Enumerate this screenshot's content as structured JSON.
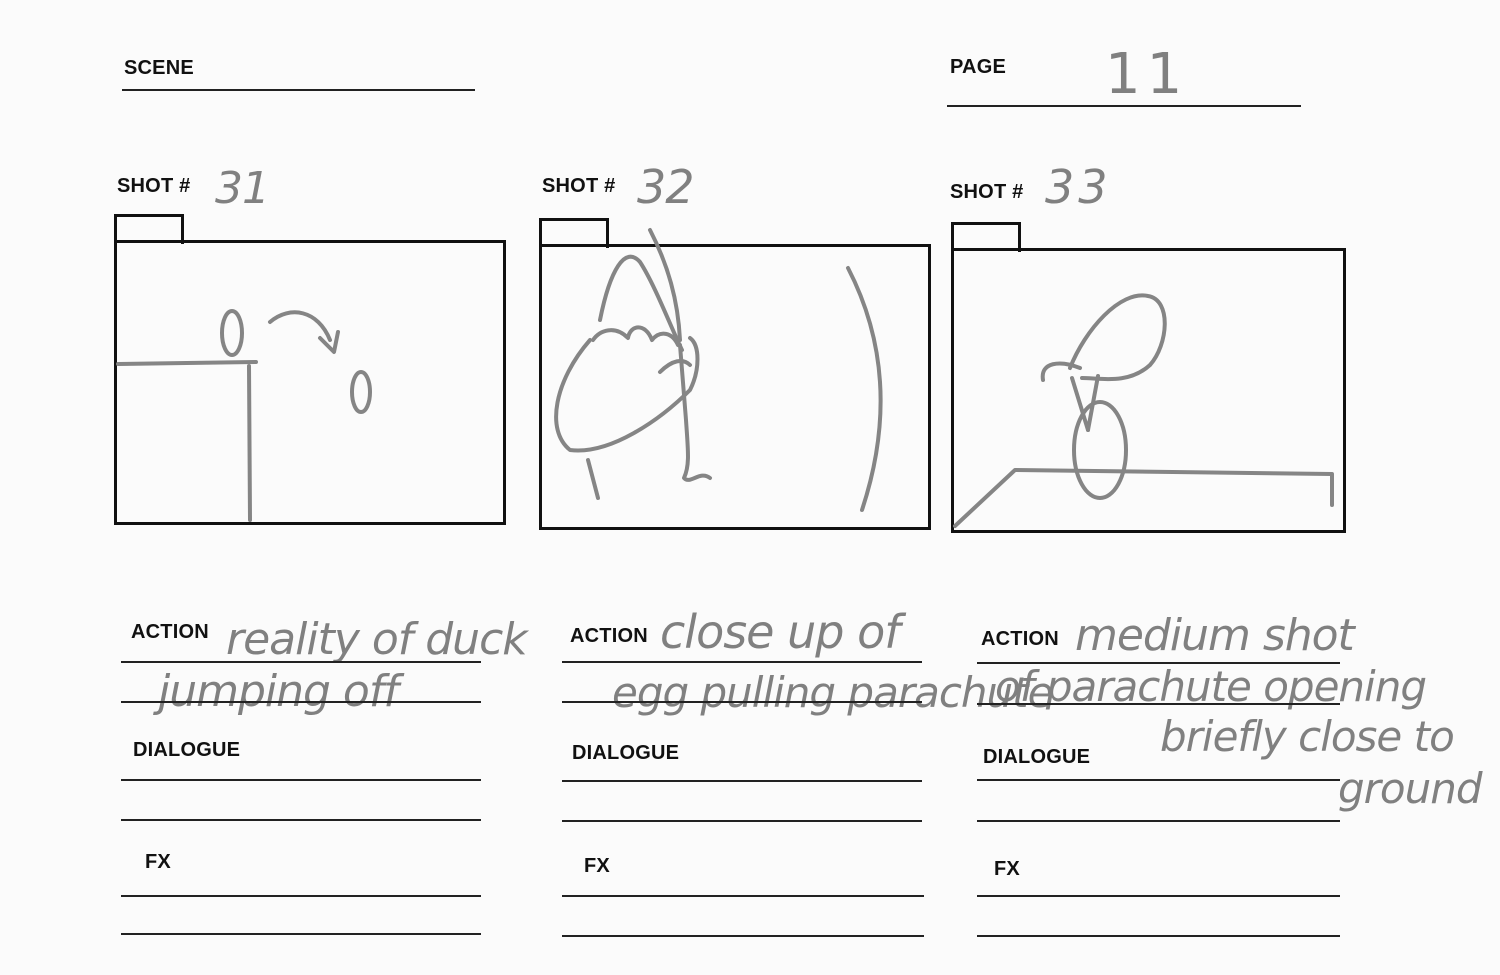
{
  "header": {
    "scene_label": "SCENE",
    "scene_value": "",
    "page_label": "PAGE",
    "page_value": "11"
  },
  "panels": [
    {
      "shot_label": "SHOT #",
      "shot_number": "31",
      "action_label": "ACTION",
      "action_lines": [
        "reality of duck",
        "jumping off"
      ],
      "dialogue_label": "DIALOGUE",
      "fx_label": "FX"
    },
    {
      "shot_label": "SHOT #",
      "shot_number": "32",
      "action_label": "ACTION",
      "action_lines": [
        "close up of",
        "egg pulling parachute"
      ],
      "dialogue_label": "DIALOGUE",
      "fx_label": "FX"
    },
    {
      "shot_label": "SHOT #",
      "shot_number": "33",
      "action_label": "ACTION",
      "action_lines": [
        "medium shot",
        "of parachute opening",
        "briefly close to",
        "ground"
      ],
      "dialogue_label": "DIALOGUE",
      "fx_label": "FX"
    }
  ],
  "colors": {
    "ink": "#111111",
    "pencil": "#808080",
    "paper": "#fbfbfb"
  }
}
